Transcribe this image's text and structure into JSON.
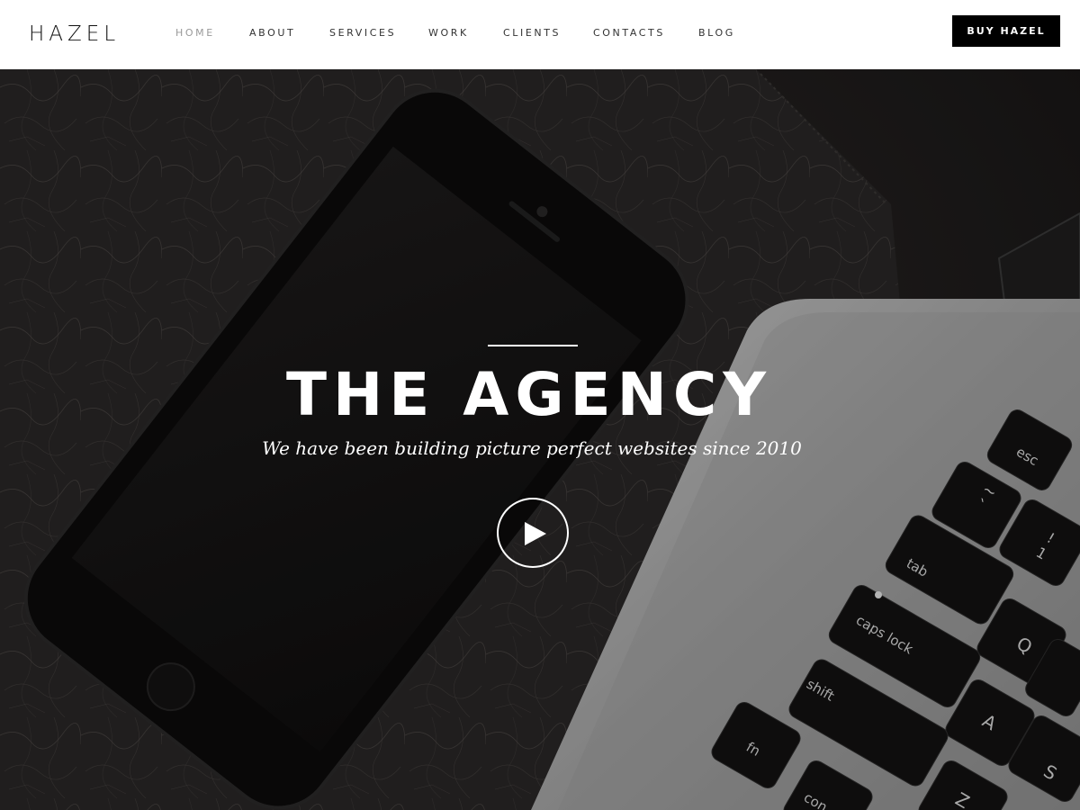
{
  "brand": {
    "logo": "HAZEL"
  },
  "nav": {
    "items": [
      {
        "label": "HOME",
        "active": true
      },
      {
        "label": "ABOUT",
        "active": false
      },
      {
        "label": "SERVICES",
        "active": false
      },
      {
        "label": "WORK",
        "active": false
      },
      {
        "label": "CLIENTS",
        "active": false
      },
      {
        "label": "CONTACTS",
        "active": false
      },
      {
        "label": "BLOG",
        "active": false
      }
    ],
    "cta": "BUY HAZEL"
  },
  "hero": {
    "title": "THE AGENCY",
    "subtitle": "We have been building picture perfect websites since 2010",
    "play_icon": "play-icon"
  },
  "keyboard": {
    "keys": [
      "esc",
      "~",
      "`",
      "!",
      "1",
      "tab",
      "Q",
      "caps lock",
      "A",
      "shift",
      "Z",
      "S",
      "fn",
      "con"
    ]
  },
  "colors": {
    "header_bg": "#ffffff",
    "cta_bg": "#000000",
    "hero_text": "#ffffff",
    "nav_active": "#999999"
  }
}
